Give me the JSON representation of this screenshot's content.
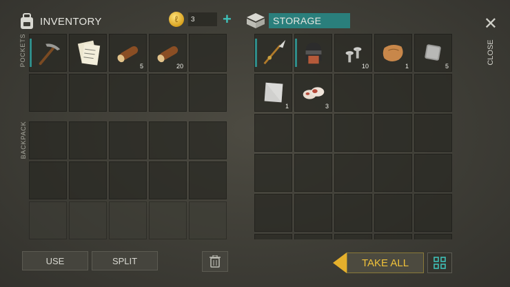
{
  "inventory": {
    "title": "INVENTORY",
    "currency_amount": "3",
    "pockets_label": "POCKETS",
    "backpack_label": "BACKPACK",
    "pockets": [
      {
        "item": "pickaxe-icon",
        "count": ""
      },
      {
        "item": "notes-icon",
        "count": ""
      },
      {
        "item": "log-icon",
        "count": "5"
      },
      {
        "item": "log-icon",
        "count": "20"
      },
      {
        "item": "",
        "count": ""
      }
    ]
  },
  "storage": {
    "title": "STORAGE",
    "items": [
      {
        "item": "spear-icon",
        "count": ""
      },
      {
        "item": "helmet-icon",
        "count": ""
      },
      {
        "item": "nails-icon",
        "count": "10"
      },
      {
        "item": "leather-icon",
        "count": "1"
      },
      {
        "item": "metal-plate-icon",
        "count": "5"
      },
      {
        "item": "metal-sheet-icon",
        "count": "1"
      },
      {
        "item": "raw-meat-icon",
        "count": "3"
      }
    ]
  },
  "actions": {
    "use": "USE",
    "split": "SPLIT",
    "take_all": "TAKE ALL",
    "close": "CLOSE"
  },
  "colors": {
    "accent": "#2a7f7c",
    "take_all": "#f0c23a",
    "plus": "#3fc0b8"
  }
}
